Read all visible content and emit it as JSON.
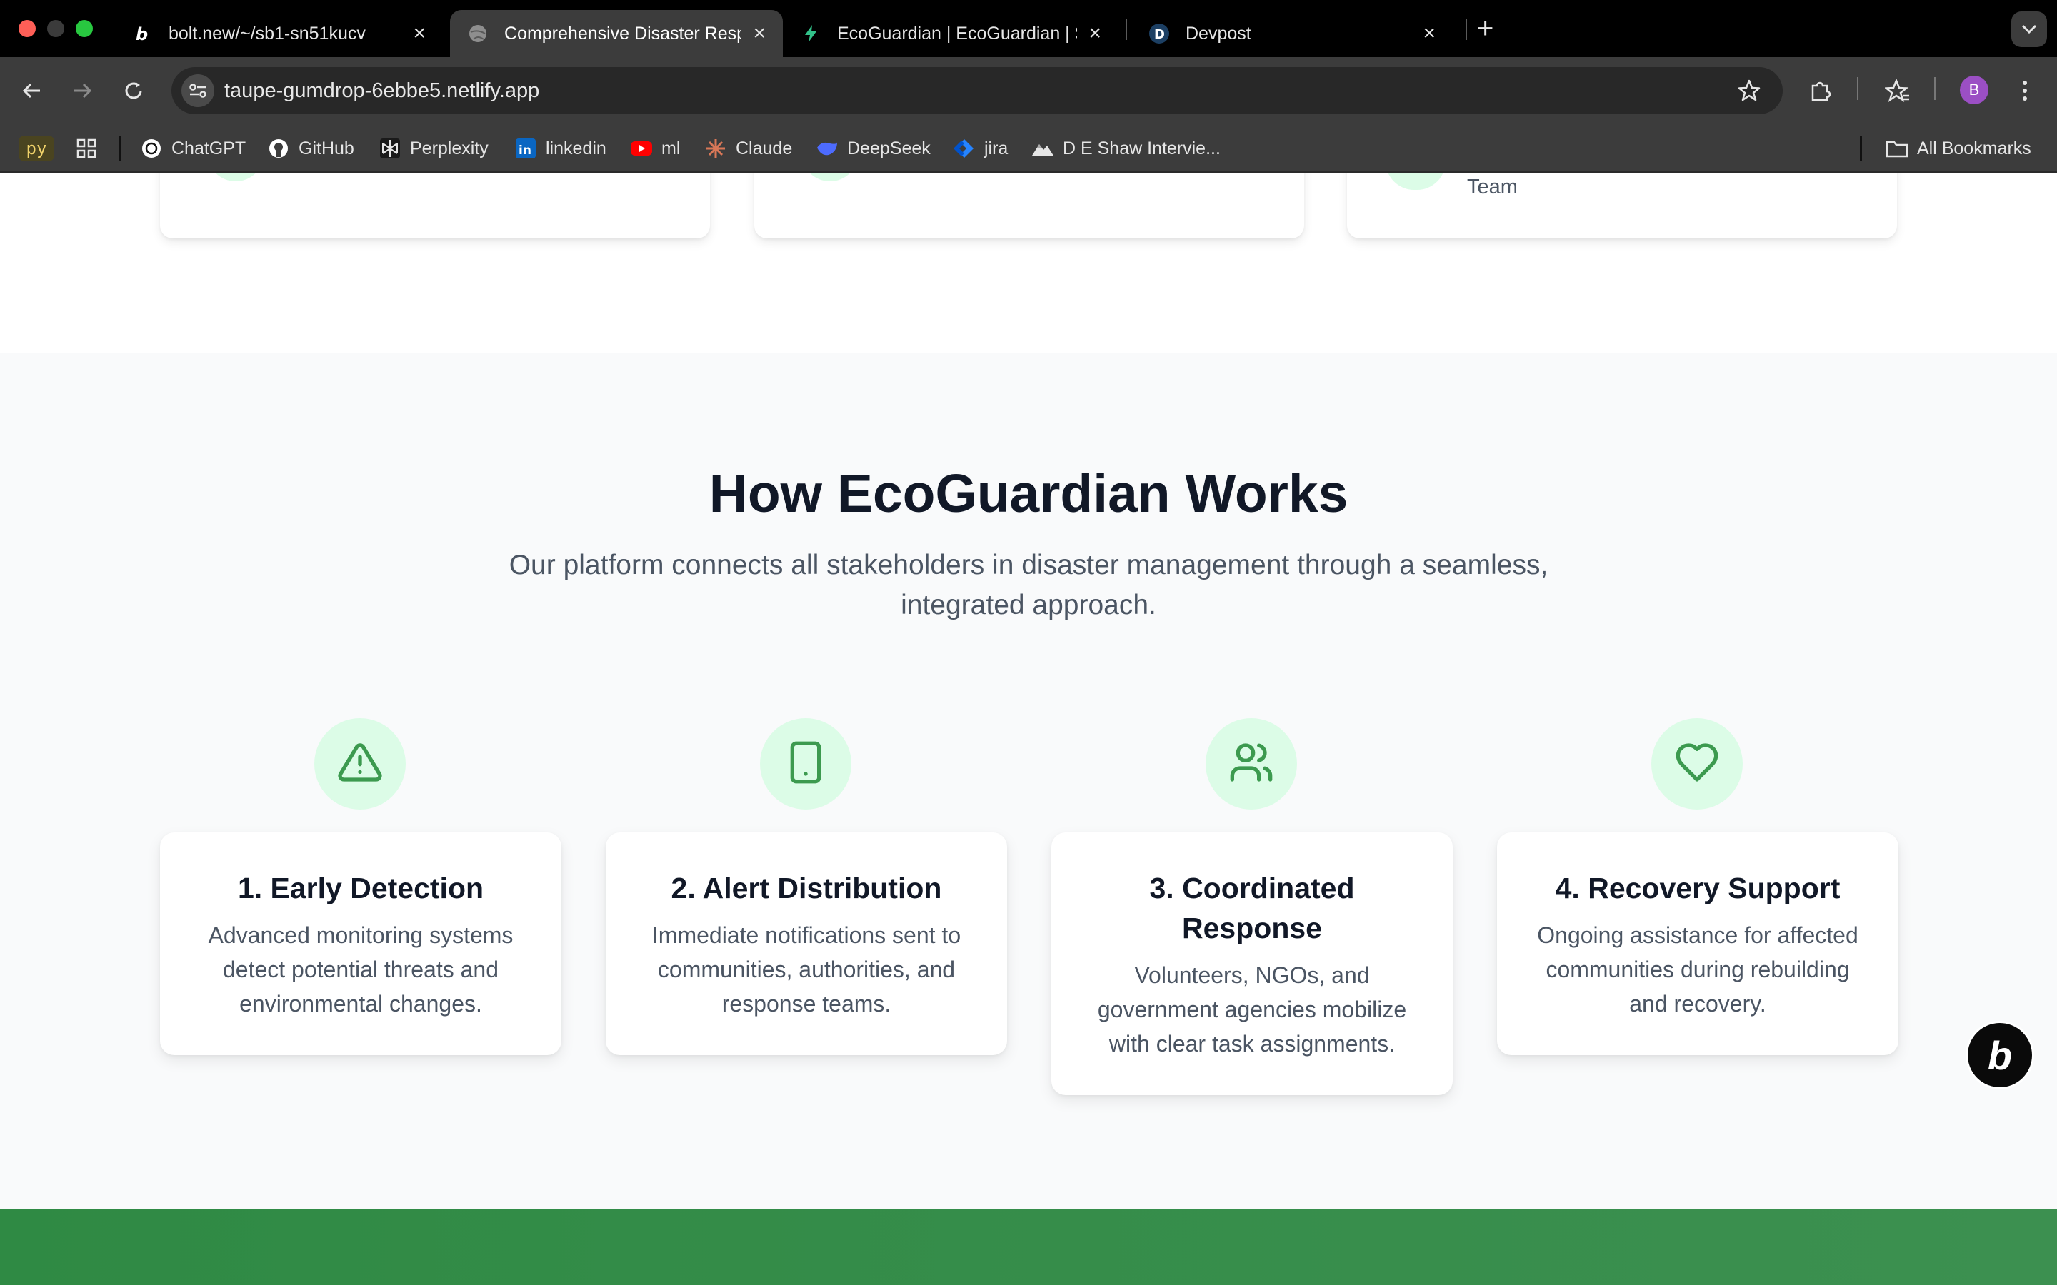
{
  "browser": {
    "tabs": [
      {
        "title": "bolt.new/~/sb1-sn51kucv",
        "favicon": "bolt-icon",
        "active": false
      },
      {
        "title": "Comprehensive Disaster Resp",
        "favicon": "globe-icon",
        "active": true
      },
      {
        "title": "EcoGuardian | EcoGuardian | S",
        "favicon": "netlify-icon",
        "active": false
      },
      {
        "title": "Devpost",
        "favicon": "devpost-icon",
        "active": false
      }
    ],
    "url": "taupe-gumdrop-6ebbe5.netlify.app",
    "profile_initial": "B",
    "bookmarks": [
      {
        "label": "ChatGPT",
        "icon": "chatgpt-icon"
      },
      {
        "label": "GitHub",
        "icon": "github-icon"
      },
      {
        "label": "Perplexity",
        "icon": "perplexity-icon"
      },
      {
        "label": "linkedin",
        "icon": "linkedin-icon"
      },
      {
        "label": "ml",
        "icon": "youtube-icon"
      },
      {
        "label": "Claude",
        "icon": "claude-icon"
      },
      {
        "label": "DeepSeek",
        "icon": "deepseek-icon"
      },
      {
        "label": "jira",
        "icon": "jira-icon"
      },
      {
        "label": "D E Shaw Intervie...",
        "icon": "mountain-icon"
      }
    ],
    "bookmark_chip": "py",
    "all_bookmarks": "All Bookmarks"
  },
  "page": {
    "prev_card_text": "Team",
    "section": {
      "title": "How EcoGuardian Works",
      "subtitle": "Our platform connects all stakeholders in disaster management through a seamless, integrated approach."
    },
    "steps": [
      {
        "icon": "alert-triangle-icon",
        "title": "1. Early Detection",
        "text": "Advanced monitoring systems detect potential threats and environmental changes."
      },
      {
        "icon": "smartphone-icon",
        "title": "2. Alert Distribution",
        "text": "Immediate notifications sent to communities, authorities, and response teams."
      },
      {
        "icon": "users-icon",
        "title": "3. Coordinated Response",
        "text": "Volunteers, NGOs, and government agencies mobilize with clear task assignments."
      },
      {
        "icon": "heart-icon",
        "title": "4. Recovery Support",
        "text": "Ongoing assistance for affected communities during rebuilding and recovery."
      }
    ],
    "badge_letter": "b"
  },
  "colors": {
    "accent_green": "#3c9a4f",
    "icon_bg": "#dcfce7",
    "heading": "#111827",
    "body_text": "#4b5563",
    "footer_green": "#2f8a44"
  }
}
